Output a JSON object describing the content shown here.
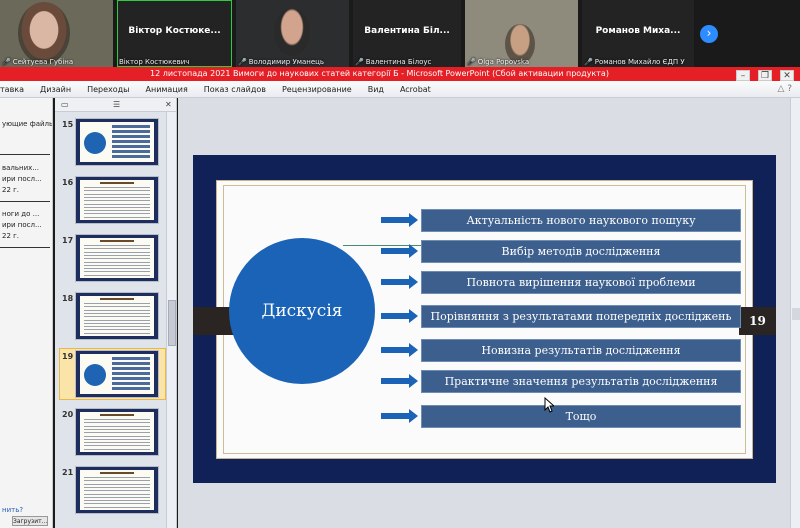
{
  "participants": [
    {
      "name": "",
      "label": "Сейтуева Губіна",
      "muted": true,
      "video": true
    },
    {
      "name": "Віктор Костюке...",
      "label": "Віктор Костюкевич",
      "muted": false,
      "video": false,
      "speaking": true
    },
    {
      "name": "",
      "label": "Володимир Уманець",
      "muted": true,
      "video": true
    },
    {
      "name": "Валентина Біл...",
      "label": "Валентина Білоус",
      "muted": true,
      "video": false
    },
    {
      "name": "",
      "label": "Olga Popovska",
      "muted": true,
      "video": true
    },
    {
      "name": "Романов Миха...",
      "label": "Романов Михайло ЄДП У",
      "muted": true,
      "video": false
    }
  ],
  "next_icon": "chevron-right-icon",
  "ppt": {
    "window_title": "12 листопада 2021 Вимоги  до наукових статей категорії Б  -  Microsoft PowerPoint (Сбой активации продукта)",
    "ribbon_tabs": [
      "тавка",
      "Дизайн",
      "Переходы",
      "Анимация",
      "Показ слайдов",
      "Рецензирование",
      "Вид",
      "Acrobat"
    ]
  },
  "left_pane": {
    "lines": [
      "ующие файлы.",
      "",
      "вальних...",
      "ири посл...",
      "22 г.",
      "",
      "ноги  до ...",
      "ири посл...",
      "22 г."
    ],
    "bottom_text": "нить?",
    "button_label": "Загрузит..."
  },
  "thumbnails": [
    {
      "num": "15",
      "style": "diagram"
    },
    {
      "num": "16",
      "style": "text"
    },
    {
      "num": "17",
      "style": "text"
    },
    {
      "num": "18",
      "style": "text"
    },
    {
      "num": "19",
      "style": "diagram",
      "selected": true
    },
    {
      "num": "20",
      "style": "text"
    },
    {
      "num": "21",
      "style": "text"
    }
  ],
  "slide": {
    "circle_text": "Дискусія",
    "slide_number": "19",
    "items": [
      "Актуальність нового наукового пошуку",
      "Вибір методів дослідження",
      "Повнота вирішення наукової проблеми",
      "Порівняння з результатами попередніх досліджень",
      "Новизна результатів дослідження",
      "Практичне значення результатів дослідження",
      "Тощо"
    ]
  },
  "colors": {
    "accent": "#1a63b7",
    "titlebar": "#e41f25",
    "slide_frame": "#0f2157",
    "box": "#3d5f8d"
  }
}
